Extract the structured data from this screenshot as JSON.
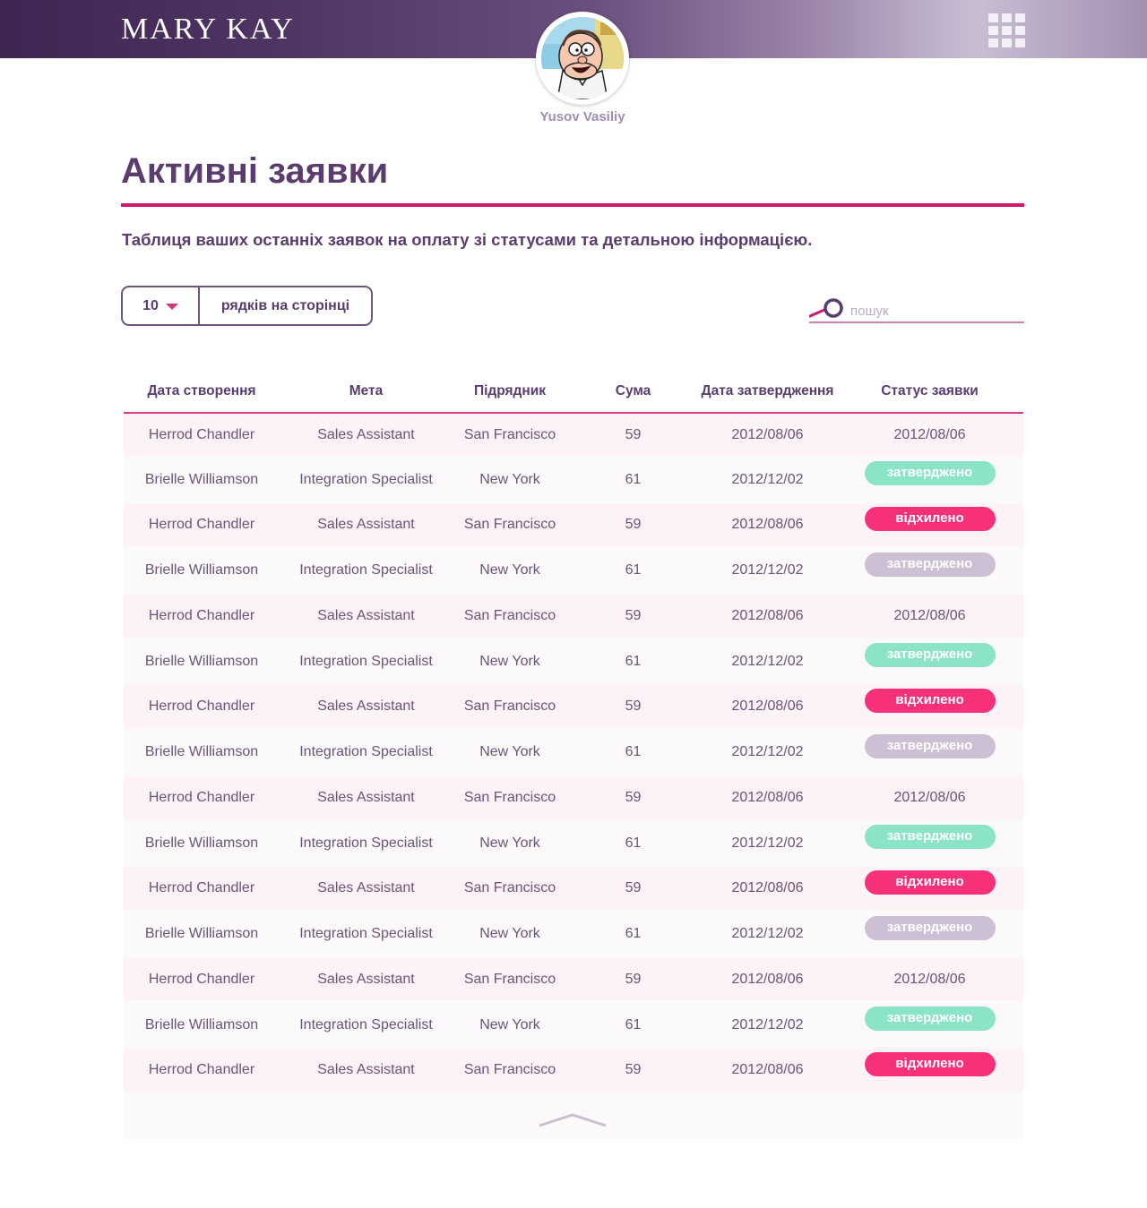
{
  "header": {
    "logo": "MARY KAY",
    "user_name": "Yusov Vasiliy"
  },
  "page": {
    "title": "Активні заявки",
    "subtitle": "Таблиця ваших останніх заявок на оплату зі статусами та детальною інформацією."
  },
  "controls": {
    "rows_per_page_value": "10",
    "rows_per_page_label": "рядків на сторінці",
    "search_placeholder": "пошук",
    "search_value": ""
  },
  "colors": {
    "accent": "#d4186f",
    "brand": "#5a3d6e",
    "approved": "#8be3c8",
    "rejected": "#f6317a",
    "pending": "#cdbfd4"
  },
  "table": {
    "columns": [
      "Дата створення",
      "Мета",
      "Підрядник",
      "Сума",
      "Дата затвердження",
      "Статус заявки"
    ],
    "rows": [
      {
        "created": "Herrod Chandler",
        "goal": "Sales Assistant",
        "contractor": "San Francisco",
        "amount": "59",
        "approved_date": "2012/08/06",
        "status_type": "text",
        "status": "2012/08/06"
      },
      {
        "created": "Brielle Williamson",
        "goal": "Integration Specialist",
        "contractor": "New York",
        "amount": "61",
        "approved_date": "2012/12/02",
        "status_type": "approved",
        "status": "затверджено"
      },
      {
        "created": "Herrod Chandler",
        "goal": "Sales Assistant",
        "contractor": "San Francisco",
        "amount": "59",
        "approved_date": "2012/08/06",
        "status_type": "rejected",
        "status": "відхилено"
      },
      {
        "created": "Brielle Williamson",
        "goal": "Integration Specialist",
        "contractor": "New York",
        "amount": "61",
        "approved_date": "2012/12/02",
        "status_type": "pending",
        "status": "затверджено"
      },
      {
        "created": "Herrod Chandler",
        "goal": "Sales Assistant",
        "contractor": "San Francisco",
        "amount": "59",
        "approved_date": "2012/08/06",
        "status_type": "text",
        "status": "2012/08/06"
      },
      {
        "created": "Brielle Williamson",
        "goal": "Integration Specialist",
        "contractor": "New York",
        "amount": "61",
        "approved_date": "2012/12/02",
        "status_type": "approved",
        "status": "затверджено"
      },
      {
        "created": "Herrod Chandler",
        "goal": "Sales Assistant",
        "contractor": "San Francisco",
        "amount": "59",
        "approved_date": "2012/08/06",
        "status_type": "rejected",
        "status": "відхилено"
      },
      {
        "created": "Brielle Williamson",
        "goal": "Integration Specialist",
        "contractor": "New York",
        "amount": "61",
        "approved_date": "2012/12/02",
        "status_type": "pending",
        "status": "затверджено"
      },
      {
        "created": "Herrod Chandler",
        "goal": "Sales Assistant",
        "contractor": "San Francisco",
        "amount": "59",
        "approved_date": "2012/08/06",
        "status_type": "text",
        "status": "2012/08/06"
      },
      {
        "created": "Brielle Williamson",
        "goal": "Integration Specialist",
        "contractor": "New York",
        "amount": "61",
        "approved_date": "2012/12/02",
        "status_type": "approved",
        "status": "затверджено"
      },
      {
        "created": "Herrod Chandler",
        "goal": "Sales Assistant",
        "contractor": "San Francisco",
        "amount": "59",
        "approved_date": "2012/08/06",
        "status_type": "rejected",
        "status": "відхилено"
      },
      {
        "created": "Brielle Williamson",
        "goal": "Integration Specialist",
        "contractor": "New York",
        "amount": "61",
        "approved_date": "2012/12/02",
        "status_type": "pending",
        "status": "затверджено"
      },
      {
        "created": "Herrod Chandler",
        "goal": "Sales Assistant",
        "contractor": "San Francisco",
        "amount": "59",
        "approved_date": "2012/08/06",
        "status_type": "text",
        "status": "2012/08/06"
      },
      {
        "created": "Brielle Williamson",
        "goal": "Integration Specialist",
        "contractor": "New York",
        "amount": "61",
        "approved_date": "2012/12/02",
        "status_type": "approved",
        "status": "затверджено"
      },
      {
        "created": "Herrod Chandler",
        "goal": "Sales Assistant",
        "contractor": "San Francisco",
        "amount": "59",
        "approved_date": "2012/08/06",
        "status_type": "rejected",
        "status": "відхилено"
      }
    ]
  },
  "icons": {
    "menu": "grid-menu-icon",
    "search": "search-icon",
    "caret": "caret-down-icon",
    "scroll_top": "chevron-up-icon"
  }
}
